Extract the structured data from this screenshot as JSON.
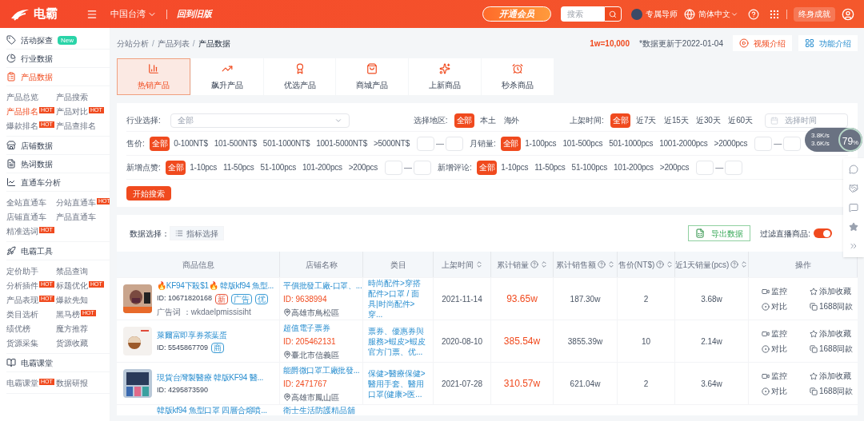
{
  "header": {
    "logo": "电霸",
    "region": "中国台湾",
    "old_version": "回到旧版",
    "vip_button": "开通会员",
    "search": {
      "placeholder": "搜索"
    },
    "tutor": "专属导师",
    "language": "简体中文",
    "achievement": "终身成就"
  },
  "sidebar": [
    {
      "kind": "section",
      "label": "活动探查",
      "badge": "New",
      "selected": false
    },
    {
      "kind": "section",
      "label": "行业数据",
      "selected": false
    },
    {
      "kind": "section",
      "label": "产品数据",
      "selected": true
    },
    {
      "kind": "links",
      "items": [
        {
          "label": "产品总览",
          "selected": false
        },
        {
          "label": "产品搜索",
          "selected": false
        },
        {
          "label": "产品排名",
          "badge": "HOT",
          "selected": true
        },
        {
          "label": "产品对比",
          "badge": "HOT",
          "selected": false
        },
        {
          "label": "爆款排名",
          "badge": "HOT",
          "selected": false
        },
        {
          "label": "产品查排名",
          "selected": false
        }
      ]
    },
    {
      "kind": "section",
      "label": "店铺数据",
      "selected": false
    },
    {
      "kind": "section",
      "label": "热词数据",
      "selected": false
    },
    {
      "kind": "section",
      "label": "直通车分析",
      "selected": false
    },
    {
      "kind": "links",
      "items": [
        {
          "label": "全站直通车",
          "selected": false
        },
        {
          "label": "分站直通车",
          "badge": "HOT",
          "selected": false
        },
        {
          "label": "店铺直通车",
          "selected": false
        },
        {
          "label": "产品直通车",
          "selected": false
        },
        {
          "label": "精准选词",
          "badge": "HOT",
          "selected": false
        }
      ]
    },
    {
      "kind": "section",
      "label": "电霸工具",
      "selected": false
    },
    {
      "kind": "links",
      "items": [
        {
          "label": "定价助手",
          "selected": false
        },
        {
          "label": "禁品查询",
          "selected": false
        },
        {
          "label": "分析插件",
          "badge": "HOT",
          "selected": false
        },
        {
          "label": "标题优化",
          "badge": "HOT",
          "selected": false
        },
        {
          "label": "产品表现",
          "badge": "HOT",
          "selected": false
        },
        {
          "label": "爆款先知",
          "selected": false
        },
        {
          "label": "类目选析",
          "selected": false
        },
        {
          "label": "黑马榜",
          "badge": "HOT",
          "selected": false
        },
        {
          "label": "绩优榜",
          "selected": false
        },
        {
          "label": "魔方推荐",
          "selected": false
        },
        {
          "label": "货源采集",
          "selected": false
        },
        {
          "label": "货源收藏",
          "selected": false
        }
      ]
    },
    {
      "kind": "section",
      "label": "电霸课堂",
      "selected": false
    },
    {
      "kind": "links",
      "items": [
        {
          "label": "电霸课堂",
          "badge": "HOT",
          "selected": false
        },
        {
          "label": "数据研报",
          "selected": false
        }
      ]
    }
  ],
  "breadcrumb": [
    {
      "label": "分站分析",
      "separator": "/"
    },
    {
      "label": "产品列表",
      "separator": "/"
    },
    {
      "label": "产品数据"
    }
  ],
  "unit_note": "1w=10,000",
  "update_note": "*数据更新于2022-01-04",
  "video_button": "视频介绍",
  "feature_button": "功能介绍",
  "tabs": [
    {
      "label": "热销产品",
      "selected": true
    },
    {
      "label": "飙升产品",
      "selected": false
    },
    {
      "label": "优选产品",
      "selected": false
    },
    {
      "label": "商城产品",
      "selected": false
    },
    {
      "label": "上新商品",
      "selected": false
    },
    {
      "label": "秒杀商品",
      "selected": false
    }
  ],
  "filters": {
    "industry": {
      "label": "行业选择:",
      "placeholder": "全部"
    },
    "region": {
      "label": "选择地区:",
      "options": [
        {
          "label": "全部",
          "selected": true
        },
        {
          "label": "本土",
          "selected": false
        },
        {
          "label": "海外",
          "selected": false
        }
      ]
    },
    "listing_time": {
      "label": "上架时间:",
      "options": [
        {
          "label": "全部",
          "selected": true
        },
        {
          "label": "近7天",
          "selected": false
        },
        {
          "label": "近15天",
          "selected": false
        },
        {
          "label": "近30天",
          "selected": false
        },
        {
          "label": "近60天",
          "selected": false
        }
      ],
      "placeholder": "选择时间"
    },
    "ranges": [
      {
        "label": "售价:",
        "separator": "—",
        "options": [
          {
            "label": "全部",
            "selected": true
          },
          {
            "label": "0-100NT$",
            "selected": false
          },
          {
            "label": "101-500NT$",
            "selected": false
          },
          {
            "label": "501-1000NT$",
            "selected": false
          },
          {
            "label": "1001-5000NT$",
            "selected": false
          },
          {
            "label": ">5000NT$",
            "selected": false
          }
        ]
      },
      {
        "label": "月销量:",
        "separator": "—",
        "options": [
          {
            "label": "全部",
            "selected": true
          },
          {
            "label": "1-100pcs",
            "selected": false
          },
          {
            "label": "101-500pcs",
            "selected": false
          },
          {
            "label": "501-1000pcs",
            "selected": false
          },
          {
            "label": "1001-2000pcs",
            "selected": false
          },
          {
            "label": ">2000pcs",
            "selected": false
          }
        ]
      },
      {
        "label": "新增点赞:",
        "separator": "—",
        "options": [
          {
            "label": "全部",
            "selected": true
          },
          {
            "label": "1-10pcs",
            "selected": false
          },
          {
            "label": "11-50pcs",
            "selected": false
          },
          {
            "label": "51-100pcs",
            "selected": false
          },
          {
            "label": "101-200pcs",
            "selected": false
          },
          {
            "label": ">200pcs",
            "selected": false
          }
        ]
      },
      {
        "label": "新增评论:",
        "separator": "—",
        "options": [
          {
            "label": "全部",
            "selected": true
          },
          {
            "label": "1-10pcs",
            "selected": false
          },
          {
            "label": "11-50pcs",
            "selected": false
          },
          {
            "label": "51-100pcs",
            "selected": false
          },
          {
            "label": "101-200pcs",
            "selected": false
          },
          {
            "label": ">200pcs",
            "selected": false
          }
        ]
      }
    ],
    "search_button": "开始搜索"
  },
  "toolbar": {
    "data_select_label": "数据选择：",
    "metric_button": "指标选择",
    "export_button": "导出数据",
    "live_filter_label": "过滤直播商品:",
    "live_filter_on": true
  },
  "table": {
    "columns": [
      {
        "label": "商品信息",
        "help": false,
        "sortable": false
      },
      {
        "label": "店铺名称",
        "help": false,
        "sortable": false
      },
      {
        "label": "类目",
        "help": false,
        "sortable": false
      },
      {
        "label": "上架时间",
        "help": false,
        "sortable": true
      },
      {
        "label": "累计销量",
        "help": true,
        "sortable": true
      },
      {
        "label": "累计销售额",
        "help": true,
        "sortable": true
      },
      {
        "label": "售价(NT$)",
        "help": true,
        "sortable": true
      },
      {
        "label": "近1天销量(pcs)",
        "help": true,
        "sortable": true
      },
      {
        "label": "操作",
        "help": false,
        "sortable": false
      }
    ],
    "rows": [
      {
        "kind": "full",
        "title": "🔥KF94下殺$1🔥 韓版kf94 魚型...",
        "id": "ID: 10671820168",
        "tags": [
          {
            "label": "新",
            "color": "#e8543a"
          },
          {
            "label": "广告",
            "color": "#3a9bd5"
          },
          {
            "label": "优",
            "color": "#3a9bd5"
          }
        ],
        "ad_word": "广告词 ：wkdaelpmissisiht",
        "shop": "平價批發工廠-口罩、...",
        "shop_id": "ID: 9638994",
        "location": "高雄市鳥松區",
        "category": "時尚配件>穿搭配件>口罩 / 面具|时尚配件>穿...",
        "date": "2021-11-14",
        "sales": "93.65w",
        "revenue": "187.30w",
        "price": "2",
        "day_sales": "3.68w",
        "actions": [
          "监控",
          "添加收藏",
          "对比",
          "1688同款"
        ]
      },
      {
        "kind": "full",
        "title": "萊爾富即享券茶葉蛋",
        "id": "ID: 5545867709",
        "tags": [
          {
            "label": "商",
            "color": "#3a9bd5"
          }
        ],
        "shop": "超值電子票券",
        "shop_id": "ID: 205462131",
        "location": "臺北市信義區",
        "category": "票券、優惠券與服務>蝦皮>蝦皮官方门票、优...",
        "date": "2020-08-10",
        "sales": "385.54w",
        "revenue": "3855.39w",
        "price": "10",
        "day_sales": "2.14w",
        "actions": [
          "监控",
          "添加收藏",
          "对比",
          "1688同款"
        ]
      },
      {
        "kind": "full",
        "title": "現貨台灣製醫療 韓版KF94 醫...",
        "id": "ID: 4295873590",
        "tags": [],
        "shop": "能爵微口罩工廠批發...",
        "shop_id": "ID: 2471767",
        "location": "高雄市鳳山區",
        "category": "保健>醫療保健>醫用手套、醫用口罩(健康>医...",
        "date": "2021-07-28",
        "sales": "310.57w",
        "revenue": "621.04w",
        "price": "2",
        "day_sales": "3.64w",
        "actions": [
          "监控",
          "添加收藏",
          "对比",
          "1688同款"
        ]
      },
      {
        "kind": "partial",
        "title": "韓版kf94 魚型口罩 四層合熔噴...",
        "shop": "衛士生活防護精品舖"
      }
    ]
  },
  "speed_widget": {
    "upload": "3.8K/s",
    "download": "3.6K/s",
    "percent": "79",
    "unit": "%"
  }
}
